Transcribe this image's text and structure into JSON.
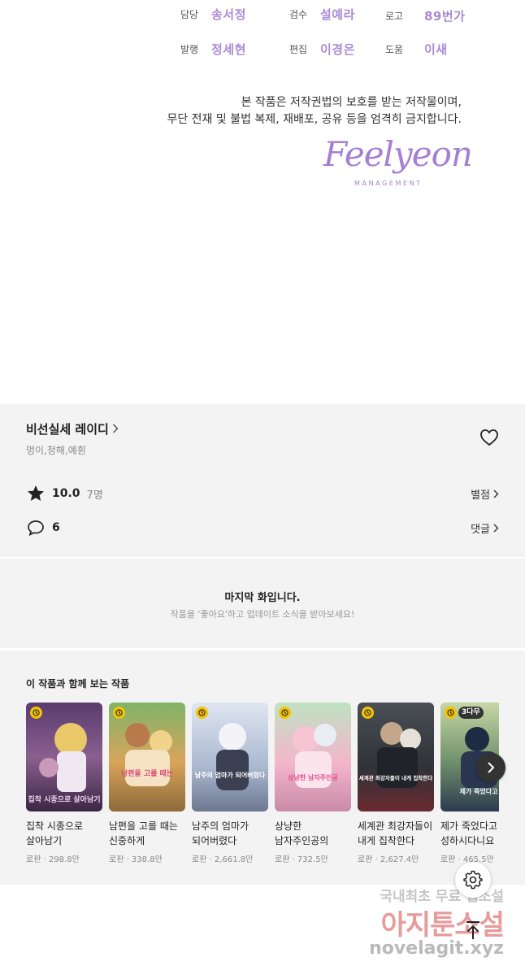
{
  "credits": [
    {
      "role": "담당",
      "name": "송서정"
    },
    {
      "role": "검수",
      "name": "설예라"
    },
    {
      "role": "로고",
      "name": "89번가"
    },
    {
      "role": "발행",
      "name": "정세현"
    },
    {
      "role": "편집",
      "name": "이경은"
    },
    {
      "role": "도움",
      "name": "이새"
    }
  ],
  "notice": {
    "line1": "본 작품은 저작권법의 보호를 받는 저작물이며,",
    "line2": "무단 전재 및 불법 복제, 재배포, 공유 등을 엄격히 금지합니다."
  },
  "logo": {
    "script": "Feelyeon",
    "sub": "MANAGEMENT"
  },
  "work": {
    "title": "비선실세 레이디",
    "authors": "멍이,청해,예휜",
    "rating": "10.0",
    "rating_count": "7명",
    "rating_link": "별점",
    "comments": "6",
    "comment_link": "댓글"
  },
  "last_episode": {
    "title": "마지막 화입니다.",
    "subtitle": "작품을 '좋아요'하고 업데이트 소식을 받아보세요!"
  },
  "recommendations": {
    "heading": "이 작품과 함께 보는 작품",
    "items": [
      {
        "title": "집착 시종으로 살아남기",
        "meta": "로판 · 298.8만",
        "cover_title": "집착 시종으로 살아남기",
        "badge": ""
      },
      {
        "title": "남편을 고를 때는 신중하게",
        "meta": "로판 · 338.8만",
        "cover_title": "남편을 고를 때는",
        "badge": ""
      },
      {
        "title": "남주의 엄마가 되어버렸다",
        "meta": "로판 · 2,661.8만",
        "cover_title": "남주의 엄마가 되어버렸다",
        "badge": ""
      },
      {
        "title": "상냥한 남자주인공의 가면을 벗...",
        "meta": "로판 · 732.5만",
        "cover_title": "상냥한 남자주인공",
        "badge": ""
      },
      {
        "title": "세계관 최강자들이 내게 집착한다",
        "meta": "로판 · 2,627.4만",
        "cover_title": "세계관 최강자들이 내게 집착한다",
        "badge": ""
      },
      {
        "title": "제가 죽었다고 성하시다니요",
        "meta": "로판 · 465.5만",
        "cover_title": "제가 죽었다고",
        "badge": "3다무"
      }
    ]
  },
  "watermark": {
    "line1": "국내최초 무료 웹소설",
    "line2": "아지툰소설",
    "line3": "novelagit.xyz"
  },
  "colors": {
    "accent": "#a98ad6",
    "panel_bg": "#f3f3f3",
    "clock_badge": "#f5c400"
  },
  "icons": [
    "heart-icon",
    "star-icon",
    "comment-icon",
    "chevron-right-icon",
    "clock-icon",
    "gear-icon",
    "arrow-up-icon"
  ]
}
